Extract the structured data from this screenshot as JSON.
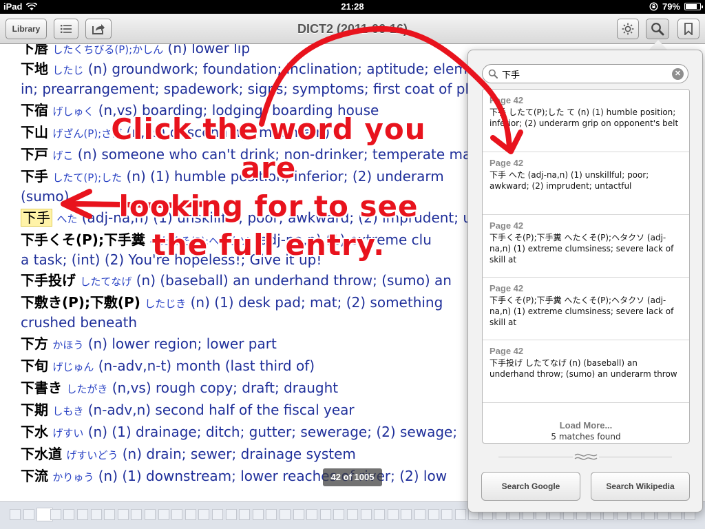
{
  "status": {
    "device": "iPad",
    "time": "21:28",
    "battery": "79%",
    "battery_level": 0.79
  },
  "toolbar": {
    "library_label": "Library",
    "title": "DICT2 (2011-06-16)"
  },
  "entries": [
    {
      "hw": "下唇",
      "kana": "したくちびる(P);かしん",
      "def": " (n) lower lip"
    },
    {
      "hw": "下地",
      "kana": "したじ",
      "def": " (n) groundwork; foundation; inclination; aptitude; elem"
    },
    {
      "hw": "",
      "kana": "",
      "def": "in; prearrangement; spadework; signs; symptoms; first coat of pla"
    },
    {
      "hw": "下宿",
      "kana": "げしゅく",
      "def": " (n,vs) boarding; lodging; boarding house"
    },
    {
      "hw": "下山",
      "kana": "げざん(P);さげ",
      "def": " (n,vs) descending (mountain)"
    },
    {
      "hw": "下戸",
      "kana": "げこ",
      "def": " (n) someone who can't drink; non-drinker; temperate ma"
    },
    {
      "hw": "下手",
      "kana": "したて(P);した",
      "def": " (n) (1) humble position; inferior; (2) underarm"
    },
    {
      "hw": "",
      "kana": "",
      "def": "(sumo)"
    },
    {
      "hw": "下手",
      "kana": "へた",
      "def": " (adj-na,n) (1) unskillful; poor; awkward; (2) imprudent; u"
    },
    {
      "hw": "下手くそ(P);下手糞",
      "kana": "へたくそ(P);ヘタクソ",
      "def": " (adj-na,n) (1) extreme clu"
    },
    {
      "hw": "",
      "kana": "",
      "def": "a task; (int) (2) You're hopeless!; Give it up!"
    },
    {
      "hw": "下手投げ",
      "kana": "したてなげ",
      "def": " (n) (baseball) an underhand throw; (sumo) an"
    },
    {
      "hw": "下敷き(P);下敷(P)",
      "kana": "したじき",
      "def": " (n) (1) desk pad; mat; (2) something"
    },
    {
      "hw": "",
      "kana": "",
      "def": "crushed beneath"
    },
    {
      "hw": "下方",
      "kana": "かほう",
      "def": " (n) lower region; lower part"
    },
    {
      "hw": "下旬",
      "kana": "げじゅん",
      "def": " (n-adv,n-t) month (last third of)"
    },
    {
      "hw": "下書き",
      "kana": "したがき",
      "def": " (n,vs) rough copy; draft; draught"
    },
    {
      "hw": "下期",
      "kana": "しもき",
      "def": " (n-adv,n) second half of the fiscal year"
    },
    {
      "hw": "下水",
      "kana": "げすい",
      "def": " (n) (1) drainage; ditch; gutter; sewerage; (2) sewage;"
    },
    {
      "hw": "下水道",
      "kana": "げすいどう",
      "def": " (n) drain; sewer; drainage system"
    },
    {
      "hw": "下流",
      "kana": "かりゅう",
      "def": " (n) (1) downstream; lower reaches of river; (2) low"
    }
  ],
  "annotation": {
    "line1": "Click the word you are",
    "line2": "looking for to see",
    "line3": "the full entry."
  },
  "page_indicator": "42 of 1005",
  "search": {
    "query": "下手",
    "results": [
      {
        "page": "Page 42",
        "text": "下手 したて(P);した て (n) (1) humble position; inferior; (2) underarm grip on opponent's belt"
      },
      {
        "page": "Page 42",
        "text": "下手 へた (adj-na,n) (1) unskillful; poor; awkward; (2) imprudent; untactful"
      },
      {
        "page": "Page 42",
        "text": "下手くそ(P);下手糞 へたくそ(P);ヘタクソ (adj-na,n) (1) extreme clumsiness; severe lack of skill at"
      },
      {
        "page": "Page 42",
        "text": "下手くそ(P);下手糞 へたくそ(P);ヘタクソ (adj-na,n) (1) extreme clumsiness; severe lack of skill at"
      },
      {
        "page": "Page 42",
        "text": "下手投げ したてなげ (n) (baseball) an underhand throw; (sumo) an underarm throw"
      }
    ],
    "load_more": "Load More...",
    "matches": "5 matches found",
    "google_label": "Search Google",
    "wikipedia_label": "Search Wikipedia"
  },
  "colors": {
    "annotation": "#e8131d",
    "definition": "#1f2f9a",
    "highlight": "#fff3a8"
  },
  "icons": [
    "wifi-icon",
    "lock-rotation-icon",
    "list-icon",
    "share-icon",
    "brightness-icon",
    "search-icon",
    "bookmark-icon",
    "clear-icon",
    "swirl-icon"
  ]
}
